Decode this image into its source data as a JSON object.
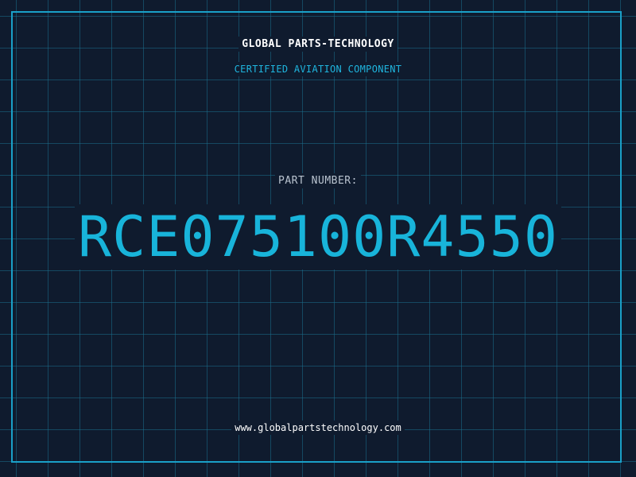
{
  "header": {
    "company": "GLOBAL PARTS-TECHNOLOGY",
    "subtitle": "CERTIFIED AVIATION COMPONENT"
  },
  "part": {
    "label": "PART NUMBER:",
    "number": "RCE075100R4550"
  },
  "footer": {
    "website": "www.globalpartstechnology.com"
  },
  "colors": {
    "background": "#0f1b2e",
    "grid": "#1a6e8a",
    "accent": "#18b4da",
    "text": "#ffffff"
  }
}
